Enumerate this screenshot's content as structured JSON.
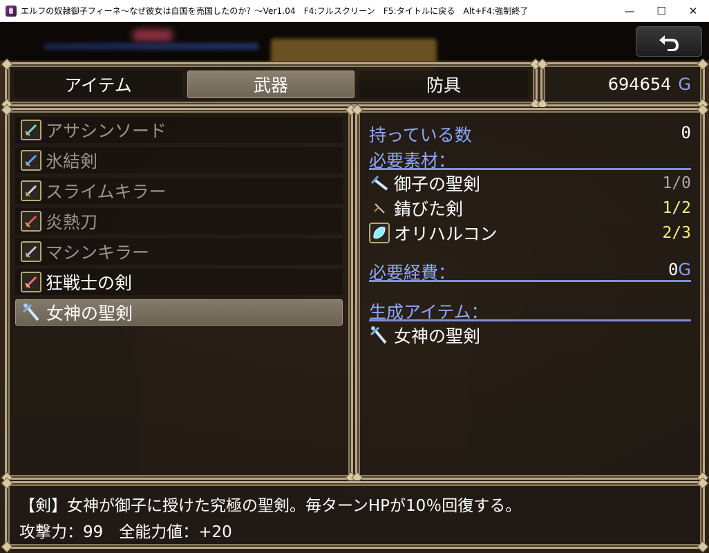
{
  "window": {
    "title": "エルフの奴隷御子フィーネ～なぜ彼女は自国を売国したのか？～Ver1.04　F4:フルスクリーン　F5:タイトルに戻る　Alt+F4:強制終了",
    "minimize_label": "—",
    "maximize_label": "☐",
    "close_label": "✕"
  },
  "tabs": [
    {
      "label": "アイテム",
      "selected": false
    },
    {
      "label": "武器",
      "selected": true
    },
    {
      "label": "防具",
      "selected": false
    }
  ],
  "gold": {
    "amount": "694654",
    "unit": "G"
  },
  "items": [
    {
      "name": "アサシンソード",
      "icon": "teal-sword-icon",
      "enabled": false,
      "selected": false
    },
    {
      "name": "氷結剣",
      "icon": "ice-sword-icon",
      "enabled": false,
      "selected": false
    },
    {
      "name": "スライムキラー",
      "icon": "slime-killer-sword-icon",
      "enabled": false,
      "selected": false
    },
    {
      "name": "炎熱刀",
      "icon": "flame-blade-icon",
      "enabled": false,
      "selected": false
    },
    {
      "name": "マシンキラー",
      "icon": "machine-killer-sword-icon",
      "enabled": false,
      "selected": false
    },
    {
      "name": "狂戦士の剣",
      "icon": "berserker-sword-icon",
      "enabled": true,
      "selected": false
    },
    {
      "name": "女神の聖剣",
      "icon": "goddess-holy-sword-icon",
      "enabled": true,
      "selected": true
    }
  ],
  "detail": {
    "owned_label": "持っている数",
    "owned_value": "0",
    "materials_label": "必要素材：",
    "materials": [
      {
        "name": "御子の聖剣",
        "count": "1/0",
        "count_color": "#a8a8a8",
        "icon": "holy-sword-icon"
      },
      {
        "name": "錆びた剣",
        "count": "1/2",
        "count_color": "#f5f07a",
        "icon": "rusty-sword-icon"
      },
      {
        "name": "オリハルコン",
        "count": "2/3",
        "count_color": "#f5f07a",
        "icon": "orichalcum-crystal-icon"
      }
    ],
    "cost_label": "必要経費：",
    "cost_value": "0",
    "cost_unit": "G",
    "result_label": "生成アイテム：",
    "result_item": "女神の聖剣",
    "result_icon": "goddess-holy-sword-icon"
  },
  "help": {
    "line1": "【剣】女神が御子に授けた究極の聖剣。毎ターンHPが10％回復する。",
    "line2": "攻撃力：99　全能力値：+20"
  }
}
